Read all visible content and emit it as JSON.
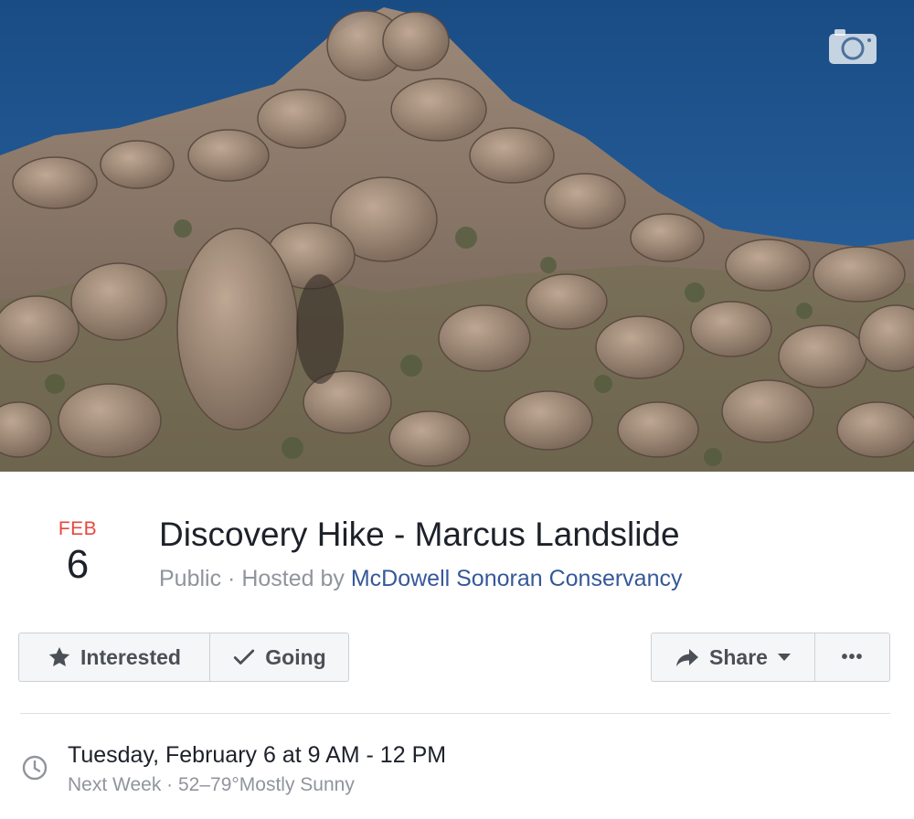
{
  "event": {
    "month": "FEB",
    "day": "6",
    "title": "Discovery Hike - Marcus Landslide",
    "privacy": "Public",
    "separator": " · ",
    "hosted_prefix": "Hosted by ",
    "host_name": "McDowell Sonoran Conservancy"
  },
  "cover": {
    "alt": "Granite boulder hill under a blue sky",
    "camera_icon": "camera-icon"
  },
  "actions": {
    "interested_label": "Interested",
    "going_label": "Going",
    "share_label": "Share",
    "more_label": "•••"
  },
  "details": {
    "time_text": "Tuesday, February 6 at 9 AM - 12 PM",
    "relative": "Next Week",
    "separator": " · ",
    "weather": "52–79°Mostly Sunny"
  },
  "colors": {
    "month_red": "#e9463f",
    "link_blue": "#365899",
    "muted_gray": "#90949c",
    "button_bg": "#f5f6f7"
  }
}
